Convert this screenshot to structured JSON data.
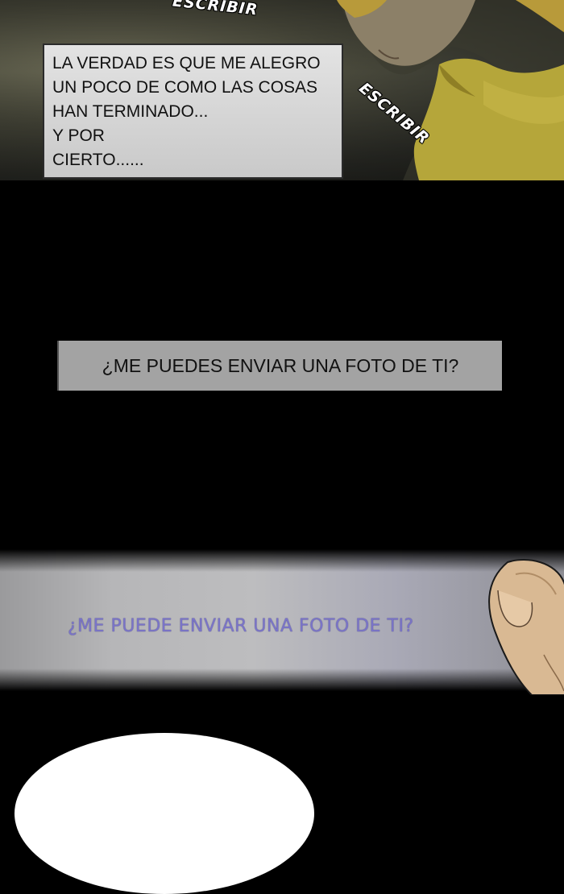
{
  "top_panel": {
    "sfx": [
      "ESCRIBIR",
      "ESCRIBIR"
    ],
    "caption_lines": [
      "LA VERDAD ES QUE ME ALEGRO",
      "UN POCO DE COMO LAS COSAS",
      "HAN TERMINADO...",
      "Y POR",
      "CIERTO......"
    ]
  },
  "middle_caption": "¿ME PUEDES ENVIAR UNA FOTO DE TI?",
  "phone_screen_text": "¿ME PUEDE ENVIAR UNA FOTO DE TI?",
  "colors": {
    "background": "#000000",
    "caption_box": "#a3a3a3",
    "phone_text": "#7a74c8",
    "shirt": "#b5a63a"
  }
}
